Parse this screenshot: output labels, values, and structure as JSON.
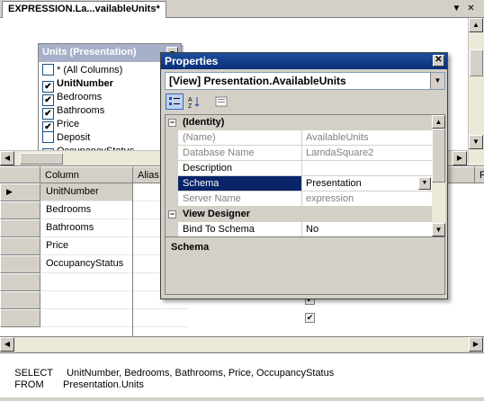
{
  "titlebar": {
    "tab_label": "EXPRESSION.La...vailableUnits*",
    "arrow_glyph": "▼",
    "close_glyph": "✕"
  },
  "table_box": {
    "title": "Units (Presentation)",
    "minimize_glyph": "–",
    "columns": [
      {
        "label": "* (All Columns)",
        "checked": false,
        "bold": false
      },
      {
        "label": "UnitNumber",
        "checked": true,
        "bold": true
      },
      {
        "label": "Bedrooms",
        "checked": true,
        "bold": false
      },
      {
        "label": "Bathrooms",
        "checked": true,
        "bold": false
      },
      {
        "label": "Price",
        "checked": true,
        "bold": false
      },
      {
        "label": "Deposit",
        "checked": false,
        "bold": false
      },
      {
        "label": "OccupancyStatus",
        "checked": true,
        "bold": false
      }
    ]
  },
  "grid": {
    "headers": {
      "column": "Column",
      "alias": "Alias",
      "f_header": "F"
    },
    "rows": [
      "UnitNumber",
      "Bedrooms",
      "Bathrooms",
      "Price",
      "OccupancyStatus",
      "",
      "",
      ""
    ],
    "current_row_glyph": "▶"
  },
  "sql": {
    "select_kw": "SELECT",
    "select_list": "UnitNumber, Bedrooms, Bathrooms, Price, OccupancyStatus",
    "from_kw": "FROM",
    "from_table": "Presentation.Units"
  },
  "properties": {
    "title": "Properties",
    "close_glyph": "✕",
    "object_selector": "[View] Presentation.AvailableUnits",
    "toolbar": {
      "categorized_icon": "categorized-icon",
      "alphabetical_icon": "alphabetical-icon",
      "property_pages_icon": "property-pages-icon"
    },
    "rows": [
      {
        "kind": "category",
        "name": "(Identity)",
        "expander": "−"
      },
      {
        "kind": "prop",
        "name": "(Name)",
        "value": "AvailableUnits",
        "readonly": true
      },
      {
        "kind": "prop",
        "name": "Database Name",
        "value": "LamdaSquare2",
        "readonly": true
      },
      {
        "kind": "prop",
        "name": "Description",
        "value": "",
        "readonly": false
      },
      {
        "kind": "prop",
        "name": "Schema",
        "value": "Presentation",
        "readonly": false,
        "selected": true
      },
      {
        "kind": "prop",
        "name": "Server Name",
        "value": "expression",
        "readonly": true
      },
      {
        "kind": "category",
        "name": "View Designer",
        "expander": "−"
      },
      {
        "kind": "prop",
        "name": "Bind To Schema",
        "value": "No",
        "readonly": false
      }
    ],
    "description_title": "Schema"
  },
  "colors": {
    "selection": "#0a246a",
    "title_gradient_top": "#1d4f9c",
    "table_header": "#a6b0c8",
    "chrome": "#d4d0c8"
  }
}
